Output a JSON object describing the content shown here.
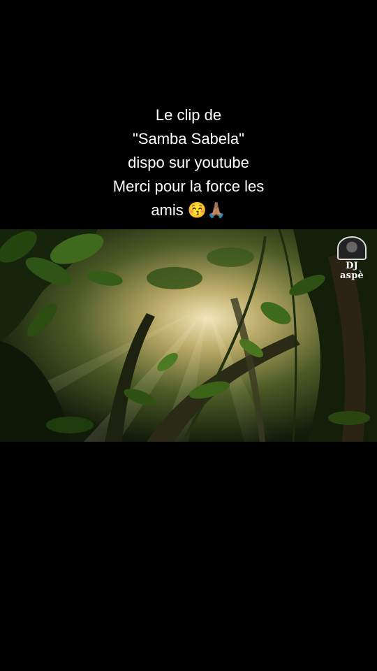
{
  "caption": {
    "line1": "Le clip de",
    "line2": "\"Samba Sabela\"",
    "line3": "dispo sur youtube",
    "line4": "Merci pour la force les",
    "line5": "amis 😚🙏🏽"
  },
  "watermark": {
    "text": "DJ aspè",
    "icon": "lion-head-icon"
  },
  "video": {
    "scene": "jungle-sunrays"
  }
}
